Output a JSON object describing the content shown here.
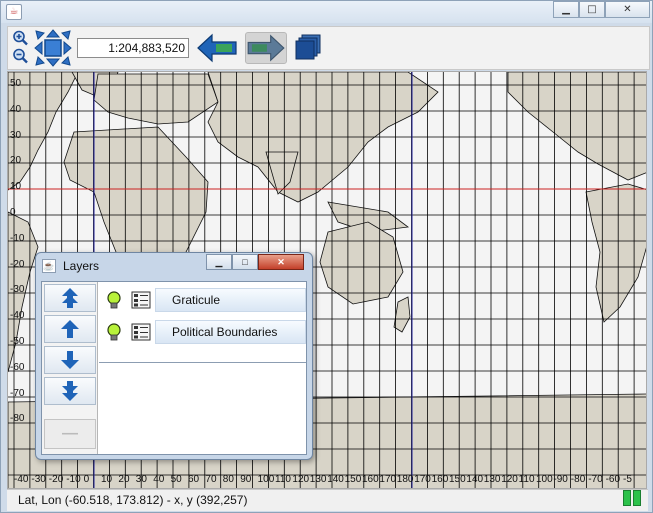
{
  "window": {
    "controls": {
      "minimize": "▁",
      "maximize": "□",
      "close": "✕"
    }
  },
  "toolbar": {
    "scale": "1:204,883,520",
    "icons": [
      "zoom-in-icon",
      "zoom-out-icon",
      "zoom-extent-icon",
      "back-icon",
      "forward-icon",
      "layers-icon"
    ]
  },
  "map": {
    "lat_labels": [
      "50",
      "40",
      "30",
      "20",
      "10",
      "0",
      "-10",
      "-20",
      "-30",
      "-40",
      "-50",
      "-60",
      "-70",
      "-80"
    ],
    "lon_labels": [
      "-40",
      "-30",
      "-20",
      "-10",
      "0",
      "10",
      "20",
      "30",
      "40",
      "50",
      "60",
      "70",
      "80",
      "90",
      "100",
      "110",
      "120",
      "130",
      "140",
      "150",
      "160",
      "170",
      "180",
      "170",
      "160",
      "150",
      "140",
      "130",
      "120",
      "110",
      "100",
      "-90",
      "-80",
      "-70",
      "-60",
      "-5"
    ],
    "colors": {
      "land": "#d8d4c8",
      "ocean": "#f4f4f4",
      "grid": "#000000",
      "equator": "#cc2222",
      "meridian": "#22229a"
    }
  },
  "status": {
    "text": "Lat, Lon (-60.518, 173.812) - x, y (392,257)"
  },
  "layers": {
    "title": "Layers",
    "controls": {
      "minimize": "▁",
      "maximize": "□",
      "close": "✕"
    },
    "items": [
      {
        "label": "Graticule"
      },
      {
        "label": "Political Boundaries"
      }
    ],
    "remove_symbol": "—"
  }
}
